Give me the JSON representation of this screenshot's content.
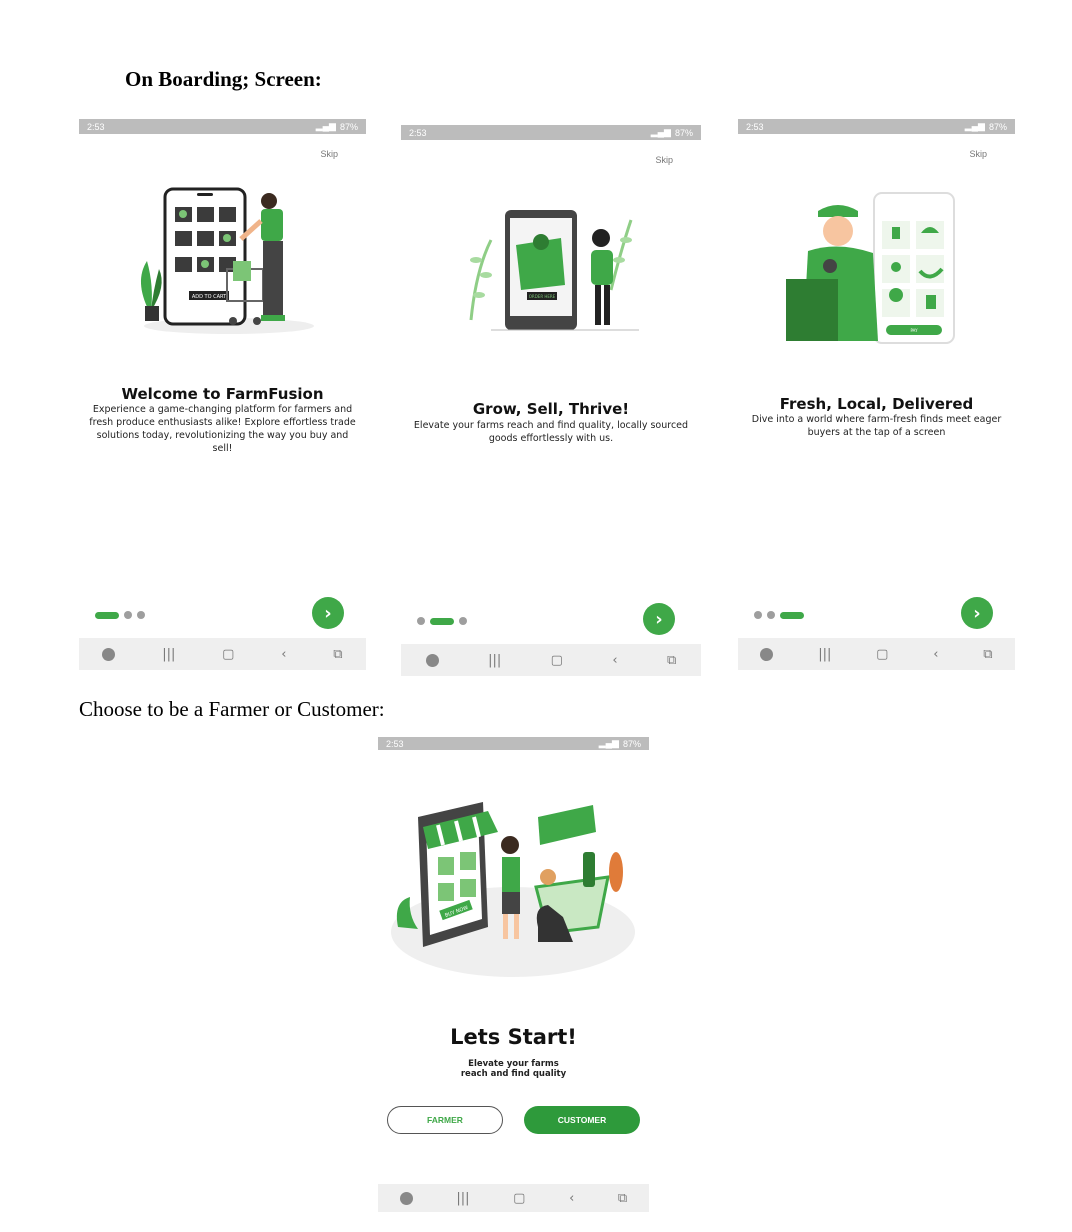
{
  "document": {
    "heading": "On Boarding; Screen:",
    "subheading": "Choose to be a Farmer or Customer:"
  },
  "status_bar": {
    "time": "2:53",
    "battery": "87%"
  },
  "onboarding_screens": [
    {
      "skip_label": "Skip",
      "title": "Welcome to FarmFusion",
      "description": "Experience a game-changing platform for farmers and fresh produce enthusiasts alike! Explore effortless trade solutions today, revolutionizing the way you buy and sell!",
      "illustration_text": "ADD TO CART",
      "active_page": 1
    },
    {
      "skip_label": "Skip",
      "title": "Grow, Sell, Thrive!",
      "description": "Elevate your farms reach and find quality, locally sourced goods effortlessly with us.",
      "illustration_text": "ORDER HERE",
      "active_page": 2
    },
    {
      "skip_label": "Skip",
      "title": "Fresh, Local, Delivered",
      "description": "Dive into a world where farm-fresh finds meet eager buyers at the tap of a screen",
      "illustration_text": "PAY",
      "active_page": 3
    }
  ],
  "role_screen": {
    "title": "Lets Start!",
    "description_line1": "Elevate your farms",
    "description_line2": "reach and find quality",
    "illustration_text": "BUY NOW",
    "farmer_label": "FARMER",
    "customer_label": "CUSTOMER"
  },
  "colors": {
    "accent": "#3fa848",
    "dark_green": "#2e7d32",
    "status_bar": "#bcbcbc"
  }
}
